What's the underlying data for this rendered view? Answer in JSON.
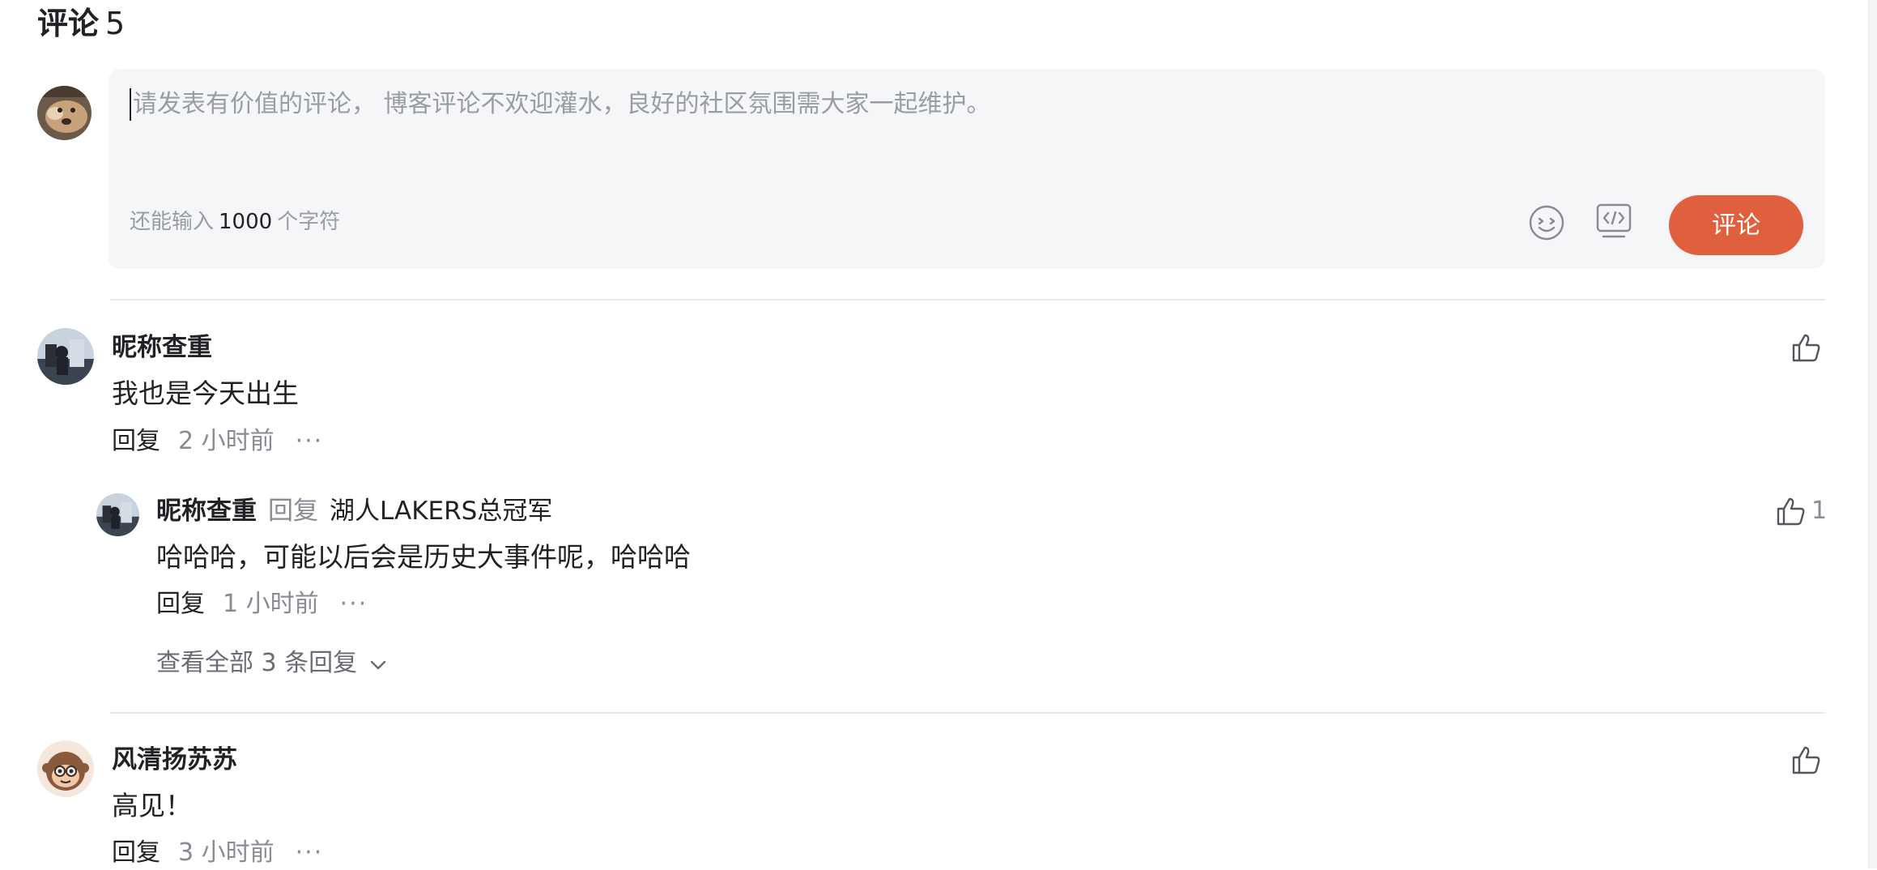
{
  "comments_header": {
    "title": "评论",
    "count": "5"
  },
  "editor": {
    "placeholder": "请发表有价值的评论， 博客评论不欢迎灌水，良好的社区氛围需大家一起维护。",
    "counter_prefix": "还能输入",
    "counter_value": "1000",
    "counter_suffix": "个字符",
    "emoji_icon": "smiley-icon",
    "code_icon": "code-icon",
    "submit_label": "评论",
    "accent_color": "#e0603e"
  },
  "comments": [
    {
      "author": "昵称查重",
      "text": "我也是今天出生",
      "reply_label": "回复",
      "time": "2 小时前",
      "more": "···",
      "like_count": "",
      "replies": [
        {
          "author": "昵称查重",
          "reply_word": "回复",
          "target": "湖人LAKERS总冠军",
          "text": "哈哈哈，可能以后会是历史大事件呢，哈哈哈",
          "reply_label": "回复",
          "time": "1 小时前",
          "more": "···",
          "like_count": "1"
        }
      ],
      "view_all": "查看全部 3 条回复"
    },
    {
      "author": "风清扬苏苏",
      "text": "高见！",
      "reply_label": "回复",
      "time": "3 小时前",
      "more": "···",
      "like_count": ""
    }
  ]
}
